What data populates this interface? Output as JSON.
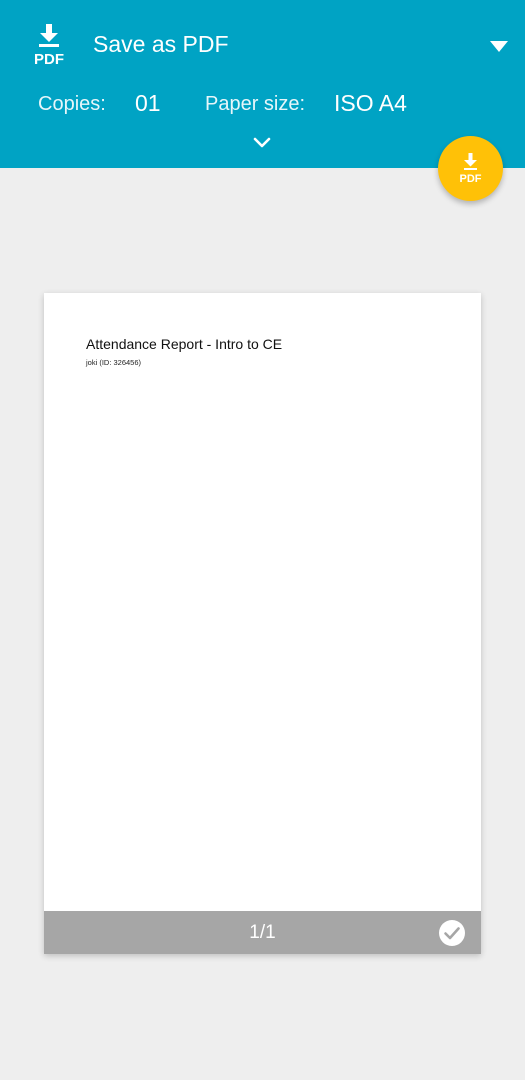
{
  "header": {
    "printer": {
      "icon": "pdf-download-icon",
      "name": "Save as PDF"
    },
    "settings": {
      "copies_label": "Copies:",
      "copies_value": "01",
      "paper_size_label": "Paper size:",
      "paper_size_value": "ISO A4"
    },
    "colors": {
      "background": "#00a3c4",
      "fab": "#ffc107"
    }
  },
  "fab": {
    "icon": "pdf-download-icon",
    "label": "PDF"
  },
  "preview": {
    "document_title": "Attendance Report - Intro to CE",
    "document_subtitle": "joki (ID: 326456)",
    "page_indicator": "1/1",
    "selected": true
  }
}
